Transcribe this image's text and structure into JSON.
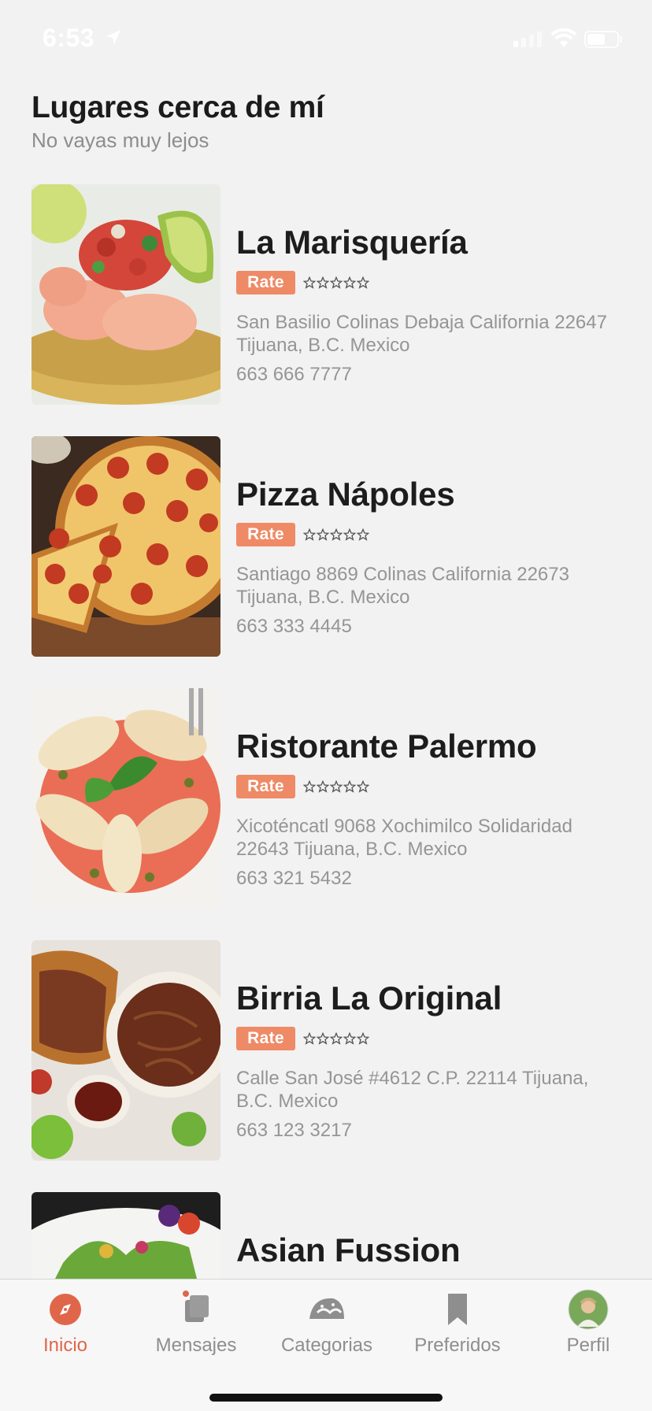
{
  "status": {
    "time": "6:53"
  },
  "header": {
    "title": "Lugares cerca de mí",
    "subtitle": "No vayas muy lejos"
  },
  "places": [
    {
      "name": "La Marisquería",
      "rate_label": "Rate",
      "rating": 0,
      "max_rating": 5,
      "address": "San Basilio Colinas Debaja California 22647 Tijuana, B.C. Mexico",
      "phone": "663 666 7777",
      "image": "shrimp-tostada"
    },
    {
      "name": "Pizza Nápoles",
      "rate_label": "Rate",
      "rating": 0,
      "max_rating": 5,
      "address": "Santiago 8869 Colinas California 22673 Tijuana, B.C. Mexico",
      "phone": "663 333 4445",
      "image": "pepperoni-pizza"
    },
    {
      "name": "Ristorante Palermo",
      "rate_label": "Rate",
      "rating": 0,
      "max_rating": 5,
      "address": "Xicoténcatl 9068 Xochimilco Solidaridad 22643 Tijuana, B.C. Mexico",
      "phone": "663 321 5432",
      "image": "stuffed-shells"
    },
    {
      "name": "Birria La Original",
      "rate_label": "Rate",
      "rating": 0,
      "max_rating": 5,
      "address": "Calle San José #4612 C.P. 22114 Tijuana, B.C. Mexico",
      "phone": "663 123 3217",
      "image": "birria-tacos"
    },
    {
      "name": "Asian Fussion",
      "rate_label": "",
      "rating": 0,
      "max_rating": 5,
      "address": "",
      "phone": "",
      "image": "asian-salad"
    }
  ],
  "tabs": [
    {
      "label": "Inicio",
      "icon": "compass-icon",
      "active": true
    },
    {
      "label": "Mensajes",
      "icon": "messages-icon",
      "active": false,
      "badge_dot": true
    },
    {
      "label": "Categorias",
      "icon": "taco-icon",
      "active": false
    },
    {
      "label": "Preferidos",
      "icon": "bookmark-icon",
      "active": false
    },
    {
      "label": "Perfil",
      "icon": "avatar",
      "active": false
    }
  ],
  "colors": {
    "accent": "#e0664a",
    "rate_badge": "#ee8a66",
    "background": "#f2f2f2",
    "secondary_text": "#959595"
  }
}
